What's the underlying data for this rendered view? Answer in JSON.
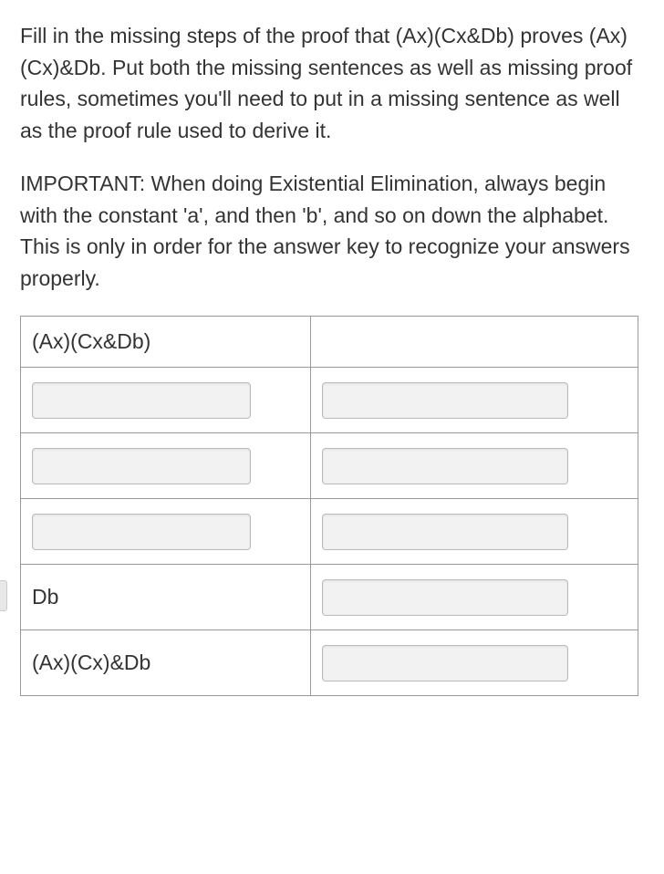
{
  "instructions": "Fill in the missing steps of the proof that (Ax)(Cx&Db) proves (Ax)(Cx)&Db. Put both the missing sentences as well as missing proof rules, sometimes you'll need to put in a missing sentence as well as the proof rule used to derive it.",
  "important": "IMPORTANT: When doing Existential Elimination, always begin with the constant 'a', and then 'b', and so on down the alphabet. This is only in order for the answer key to recognize your answers properly.",
  "rows": [
    {
      "left_type": "text",
      "left_value": "(Ax)(Cx&Db)",
      "right_type": "empty",
      "right_value": ""
    },
    {
      "left_type": "input",
      "left_value": "",
      "right_type": "input",
      "right_value": ""
    },
    {
      "left_type": "input",
      "left_value": "",
      "right_type": "input",
      "right_value": ""
    },
    {
      "left_type": "input",
      "left_value": "",
      "right_type": "input",
      "right_value": ""
    },
    {
      "left_type": "text",
      "left_value": "Db",
      "right_type": "input",
      "right_value": ""
    },
    {
      "left_type": "text",
      "left_value": "(Ax)(Cx)&Db",
      "right_type": "input",
      "right_value": ""
    }
  ]
}
